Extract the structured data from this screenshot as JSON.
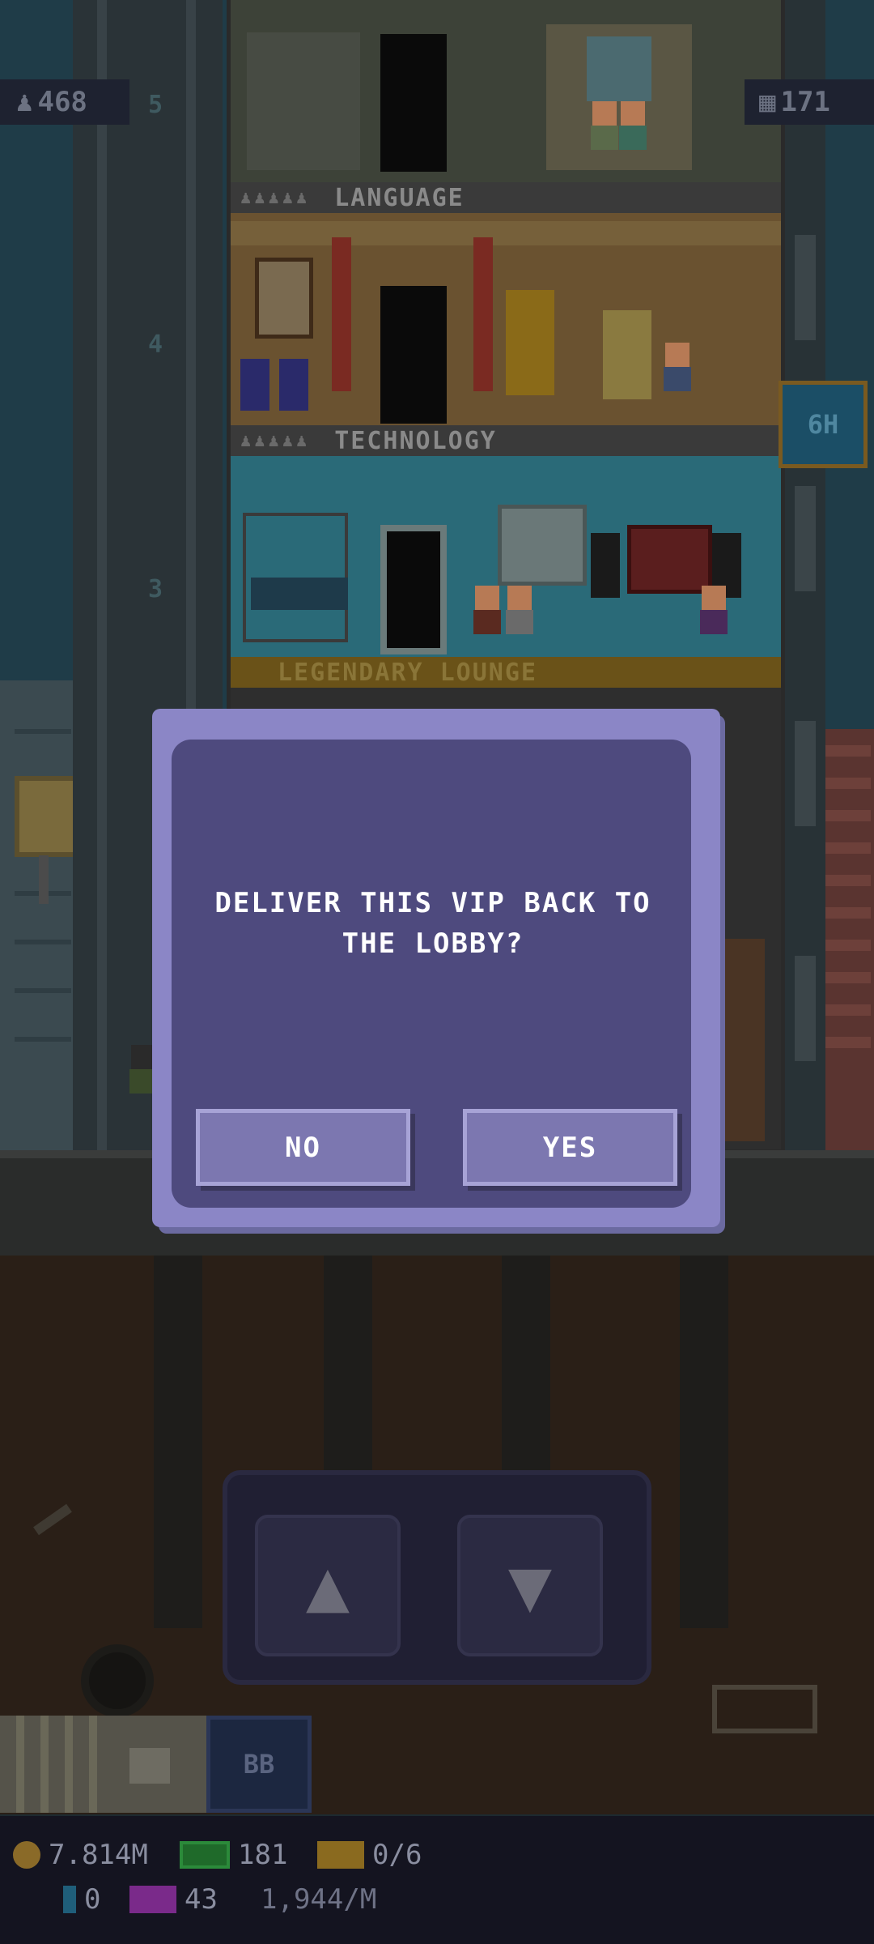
{
  "tower": {
    "population": "468",
    "floor_count": "171",
    "shaft_floor_numbers": [
      "5",
      "4",
      "3"
    ],
    "floors": [
      {
        "name": "LANGUAGE",
        "icon": "people-row-icon"
      },
      {
        "name": "TECHNOLOGY",
        "icon": "people-row-icon"
      },
      {
        "name": "LEGENDARY LOUNGE",
        "icon": ""
      }
    ],
    "timer_label": "6H"
  },
  "dialog": {
    "message": "DELIVER THIS VIP BACK TO THE LOBBY?",
    "no_label": "NO",
    "yes_label": "YES"
  },
  "elevator_controls": {
    "up_icon": "arrow-up-icon",
    "down_icon": "arrow-down-icon"
  },
  "toolbar": {
    "crate_icon": "crate-icon",
    "bb_label": "BB"
  },
  "status": {
    "coins": "7.814M",
    "bux": "181",
    "tickets": "0/6",
    "gems": "0",
    "vip_count": "43",
    "rate": "1,944/M"
  },
  "colors": {
    "dialog_border": "#8b86c6",
    "dialog_fill": "#4e4a7e",
    "dialog_button": "#7c77b0",
    "legendary_bar": "#7a5a20"
  }
}
